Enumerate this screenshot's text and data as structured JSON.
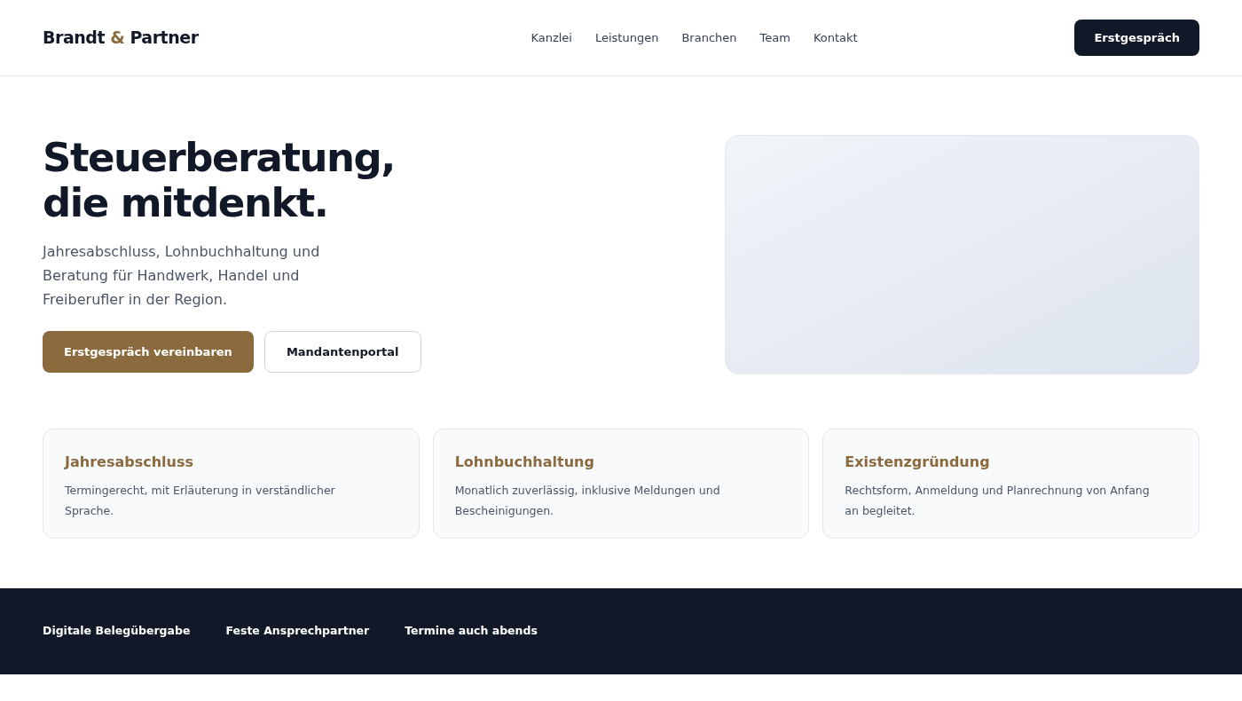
{
  "header": {
    "logo": {
      "part_1": "Brandt",
      "ampersand": "&",
      "part_2": "Partner"
    },
    "nav": [
      {
        "label": "Kanzlei"
      },
      {
        "label": "Leistungen"
      },
      {
        "label": "Branchen"
      },
      {
        "label": "Team"
      },
      {
        "label": "Kontakt"
      }
    ],
    "cta": "Erstgespräch"
  },
  "hero": {
    "headline_lines": [
      "Steuerberatung,",
      "die mitdenkt."
    ],
    "text": "Jahresabschluss, Lohnbuchhaltung und Beratung für Handwerk, Handel und Freiberufler in der Region.",
    "buttons": [
      {
        "label": "Erstgespräch vereinbaren",
        "kind": "primary"
      },
      {
        "label": "Mandantenportal",
        "kind": "secondary"
      }
    ]
  },
  "services": [
    {
      "title": "Jahresabschluss",
      "text": "Termingerecht, mit Erläuterung in verständlicher Sprache."
    },
    {
      "title": "Lohnbuchhaltung",
      "text": "Monatlich zuverlässig, inklusive Meldungen und Bescheinigungen."
    },
    {
      "title": "Existenzgründung",
      "text": "Rechtsform, Anmeldung und Planrechnung von Anfang an begleitet."
    }
  ],
  "footer": {
    "items": [
      "Digitale Belegübergabe",
      "Feste Ansprechpartner",
      "Termine auch abends"
    ]
  }
}
